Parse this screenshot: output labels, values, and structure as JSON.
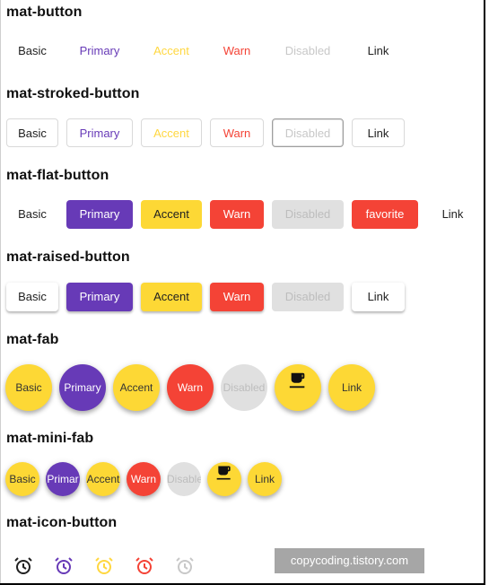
{
  "sections": {
    "button": "mat-button",
    "stroked": "mat-stroked-button",
    "flat": "mat-flat-button",
    "raised": "mat-raised-button",
    "fab": "mat-fab",
    "mini_fab": "mat-mini-fab",
    "icon_button": "mat-icon-button"
  },
  "labels": {
    "basic": "Basic",
    "primary": "Primary",
    "accent": "Accent",
    "warn": "Warn",
    "disabled": "Disabled",
    "link": "Link",
    "favorite": "favorite"
  },
  "mini_labels": {
    "basic": "Basic",
    "primary": "Primar",
    "accent": "Accent",
    "warn": "Warn",
    "disabled": "Disable",
    "link": "Link"
  },
  "icons": {
    "coffee": "coffee-icon",
    "alarm": "alarm-icon"
  },
  "colors": {
    "primary": "#673ab7",
    "accent": "#fdd835",
    "warn": "#f44336",
    "disabled": "#e0e0e0"
  },
  "watermark": "copycoding.tistory.com"
}
